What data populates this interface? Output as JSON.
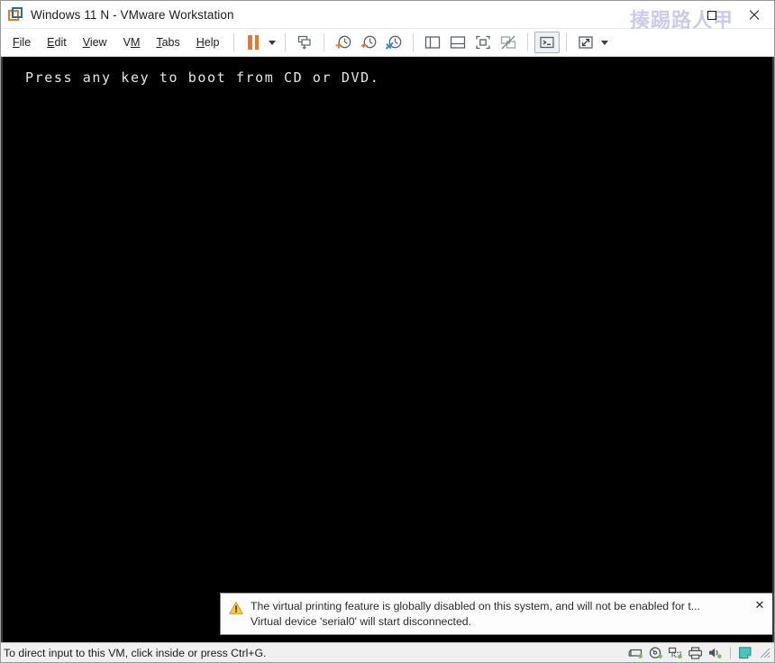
{
  "window": {
    "title": "Windows 11 N - VMware Workstation",
    "app_icon": "vmware-logo-icon",
    "watermark": "揍踢路人甲",
    "controls": {
      "maximize_icon": "maximize-icon",
      "close_icon": "close-icon"
    }
  },
  "menubar": {
    "items": [
      {
        "label": "File",
        "accel": "F",
        "pre": "",
        "post": "ile"
      },
      {
        "label": "Edit",
        "accel": "E",
        "pre": "",
        "post": "dit"
      },
      {
        "label": "View",
        "accel": "V",
        "pre": "",
        "post": "iew"
      },
      {
        "label": "VM",
        "accel": "M",
        "pre": "V",
        "post": ""
      },
      {
        "label": "Tabs",
        "accel": "T",
        "pre": "",
        "post": "abs"
      },
      {
        "label": "Help",
        "accel": "H",
        "pre": "",
        "post": "elp"
      }
    ]
  },
  "toolbar": {
    "buttons": [
      {
        "name": "suspend-button",
        "icon": "pause-icon",
        "title": "Suspend this virtual machine",
        "active": false
      },
      {
        "name": "suspend-dropdown",
        "icon": "chevron-down-icon",
        "title": "Power options",
        "active": false
      },
      {
        "name": "send-ctrl-alt-del-button",
        "icon": "send-key-icon",
        "title": "Send Ctrl+Alt+Delete",
        "active": false
      },
      {
        "name": "take-snapshot-button",
        "icon": "snapshot-add-icon",
        "title": "Take a snapshot of this VM",
        "active": false
      },
      {
        "name": "revert-snapshot-button",
        "icon": "snapshot-revert-icon",
        "title": "Revert this VM to its parent snapshot",
        "active": false
      },
      {
        "name": "snapshot-manager-button",
        "icon": "snapshot-manager-icon",
        "title": "Manage snapshots for this VM",
        "active": false
      },
      {
        "name": "show-library-button",
        "icon": "panel-left-icon",
        "title": "Show or hide the Library",
        "active": false
      },
      {
        "name": "show-thumbnails-button",
        "icon": "panel-bottom-icon",
        "title": "Show or hide thumbnail bar",
        "active": false
      },
      {
        "name": "fullscreen-button",
        "icon": "fullscreen-icon",
        "title": "Enter full screen mode",
        "active": false
      },
      {
        "name": "unity-button",
        "icon": "unity-disabled-icon",
        "title": "Unity mode",
        "active": false
      },
      {
        "name": "console-view-button",
        "icon": "console-icon",
        "title": "Console view",
        "active": true
      },
      {
        "name": "stretch-guest-button",
        "icon": "stretch-icon",
        "title": "Stretch guest display",
        "active": false
      },
      {
        "name": "stretch-dropdown",
        "icon": "chevron-down-icon",
        "title": "Display options",
        "active": false
      }
    ]
  },
  "vm_screen": {
    "boot_message": "Press any key to boot from CD or DVD.",
    "background": "#000000",
    "foreground": "#e6e6e6"
  },
  "notification": {
    "icon": "warning-icon",
    "line1": "The virtual printing feature is globally disabled on this system, and will not be enabled for t...",
    "line2": "Virtual device 'serial0' will start disconnected.",
    "close_label": "✕",
    "accent": "#ffc107"
  },
  "statusbar": {
    "message": "To direct input to this VM, click inside or press Ctrl+G.",
    "devices": [
      {
        "name": "hard-disk-icon",
        "title": "Hard Disk",
        "connected": true
      },
      {
        "name": "cd-dvd-icon",
        "title": "CD/DVD",
        "connected": true
      },
      {
        "name": "network-adapter-icon",
        "title": "Network Adapter",
        "connected": true
      },
      {
        "name": "printer-icon",
        "title": "Printer",
        "connected": false
      },
      {
        "name": "sound-card-icon",
        "title": "Sound Card",
        "connected": true
      }
    ],
    "message_indicator": "message-log-icon",
    "resize_grip": "resize-grip-icon",
    "connected_color": "#6fc043"
  }
}
